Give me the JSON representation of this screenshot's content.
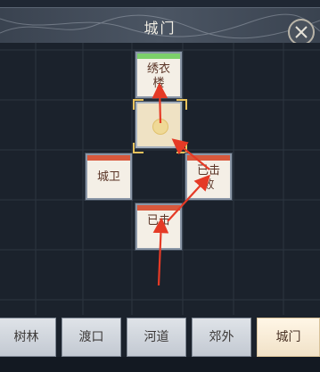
{
  "header": {
    "title": "城门"
  },
  "tiles": {
    "top": "绣衣\n楼",
    "left": "城卫",
    "right": "已击\n败",
    "bottom": "已击\n"
  },
  "tabs": [
    "树林",
    "渡口",
    "河道",
    "郊外",
    "城门"
  ],
  "colors": {
    "accent_red": "#d8583c",
    "accent_green": "#7ccf6a",
    "gold": "#e8c25c"
  }
}
